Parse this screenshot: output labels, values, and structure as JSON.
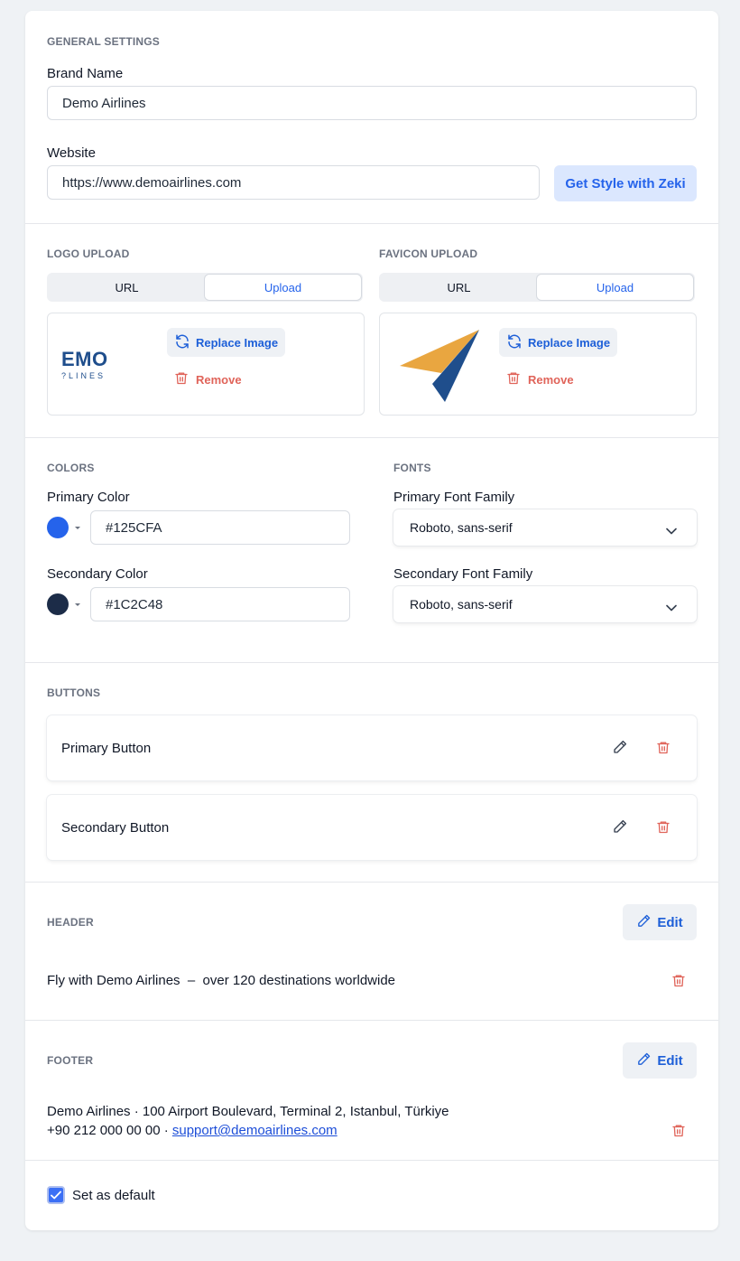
{
  "general": {
    "title": "GENERAL SETTINGS",
    "brand_label": "Brand Name",
    "brand_value": "Demo Airlines",
    "website_label": "Website",
    "website_value": "https://www.demoairlines.com",
    "zeki_button": "Get Style with Zeki"
  },
  "logo": {
    "title": "LOGO UPLOAD",
    "tab_url": "URL",
    "tab_upload": "Upload",
    "preview_text_main": "EMO",
    "preview_text_sub": "?LINES",
    "replace_label": "Replace Image",
    "remove_label": "Remove"
  },
  "favicon": {
    "title": "FAVICON UPLOAD",
    "tab_url": "URL",
    "tab_upload": "Upload",
    "replace_label": "Replace Image",
    "remove_label": "Remove"
  },
  "colors": {
    "title": "COLORS",
    "primary_label": "Primary Color",
    "primary_value": "#125CFA",
    "primary_swatch": "#2563eb",
    "secondary_label": "Secondary Color",
    "secondary_value": "#1C2C48",
    "secondary_swatch": "#1c2c48"
  },
  "fonts": {
    "title": "FONTS",
    "primary_label": "Primary Font Family",
    "primary_value": "Roboto, sans-serif",
    "secondary_label": "Secondary Font Family",
    "secondary_value": "Roboto, sans-serif"
  },
  "buttons": {
    "title": "BUTTONS",
    "items": [
      {
        "label": "Primary Button"
      },
      {
        "label": "Secondary Button"
      }
    ]
  },
  "header": {
    "title": "HEADER",
    "edit_label": "Edit",
    "text": "Fly with Demo Airlines  –  over 120 destinations worldwide"
  },
  "footer": {
    "title": "FOOTER",
    "edit_label": "Edit",
    "line1": "Demo Airlines · 100 Airport Boulevard, Terminal 2, Istanbul, Türkiye",
    "line2_prefix": "+90 212 000 00 00 · ",
    "line2_link": "support@demoairlines.com"
  },
  "default": {
    "label": "Set as default",
    "checked": true
  },
  "theme": {
    "accent": "#2563eb",
    "danger": "#e0645a",
    "logo_navy": "#1f4e8c",
    "logo_orange": "#e9a640"
  }
}
